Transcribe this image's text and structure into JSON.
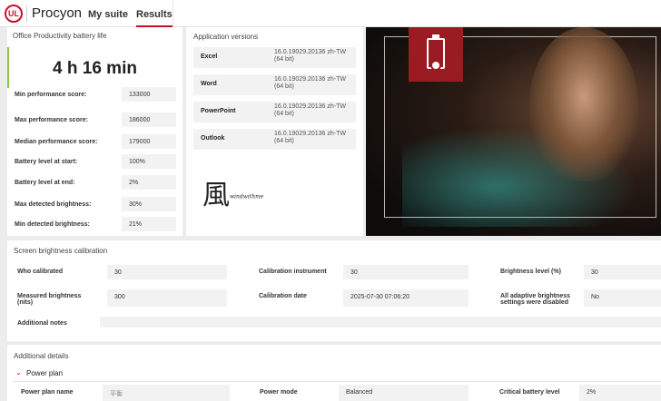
{
  "header": {
    "logo": "UL",
    "brand": "Procyon",
    "nav": [
      "My suite",
      "Results"
    ]
  },
  "battery": {
    "title": "Office Productivity battery life",
    "result": "4 h 16 min",
    "rows": [
      {
        "label": "Min performance score:",
        "value": "133000"
      },
      {
        "label": "Max performance score:",
        "value": "186000"
      },
      {
        "label": "Median performance score:",
        "value": "179000"
      },
      {
        "label": "Battery level at start:",
        "value": "100%"
      },
      {
        "label": "Battery level at end:",
        "value": "2%"
      },
      {
        "label": "Max detected brightness:",
        "value": "30%"
      },
      {
        "label": "Min detected brightness:",
        "value": "21%"
      }
    ]
  },
  "apps": {
    "title": "Application versions",
    "items": [
      {
        "name": "Excel",
        "version": "16.0.19029.20136 zh-TW (64 bit)"
      },
      {
        "name": "Word",
        "version": "16.0.19029.20136 zh-TW (64 bit)"
      },
      {
        "name": "PowerPoint",
        "version": "16.0.19029.20136 zh-TW (64 bit)"
      },
      {
        "name": "Outlook",
        "version": "16.0.19029.20136 zh-TW (64 bit)"
      }
    ],
    "watermark": "風 windwithme"
  },
  "calibration": {
    "title": "Screen brightness calibration",
    "who_label": "Who calibrated",
    "who": "30",
    "instrument_label": "Calibration instrument",
    "instrument": "30",
    "level_label": "Brightness level (%)",
    "level": "30",
    "measured_label": "Measured brightness (nits)",
    "measured": "300",
    "date_label": "Calibration date",
    "date": "2025-07-30 07:06:20",
    "adaptive_label": "All adaptive brightness settings were disabled",
    "adaptive": "No",
    "notes_label": "Additional notes",
    "notes": ""
  },
  "details": {
    "title": "Additional details",
    "section": "Power plan",
    "plan_label": "Power plan name",
    "plan": "平衡",
    "mode_label": "Power mode",
    "mode": "Balanced",
    "critical_label": "Critical battery level",
    "critical": "2%"
  },
  "colors": {
    "accent": "#c8102e",
    "green": "#8dc63f"
  }
}
